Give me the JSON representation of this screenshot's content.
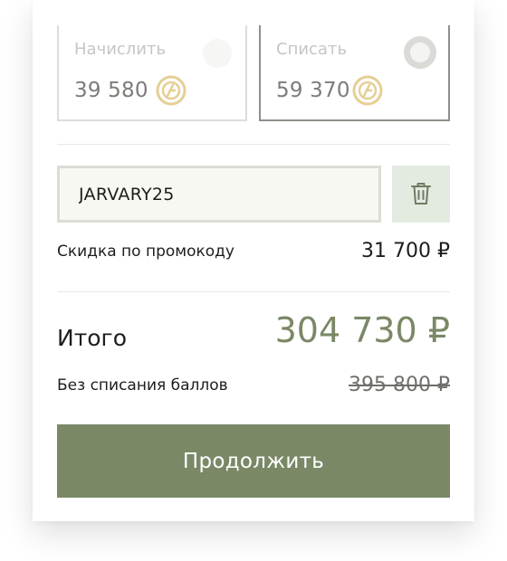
{
  "points": {
    "accrue": {
      "label": "Начислить",
      "amount": "39 580",
      "icon": "bonus-coin-icon",
      "selected": false
    },
    "spend": {
      "label": "Списать",
      "amount": "59 370",
      "icon": "bonus-coin-icon",
      "selected": true
    }
  },
  "promo": {
    "code": "JARVARY25",
    "delete_icon": "trash-icon",
    "discount_label": "Скидка по промокоду",
    "discount_value": "31 700 ₽"
  },
  "summary": {
    "total_label": "Итого",
    "total_value": "304 730 ₽",
    "without_points_label": "Без списания баллов",
    "without_points_value": "395 800 ₽"
  },
  "actions": {
    "continue_label": "Продолжить"
  },
  "colors": {
    "accent": "#7a8866",
    "coin": "#e6cf95",
    "delete_bg": "#e3ebe0",
    "input_bg": "#f8f8f3"
  }
}
